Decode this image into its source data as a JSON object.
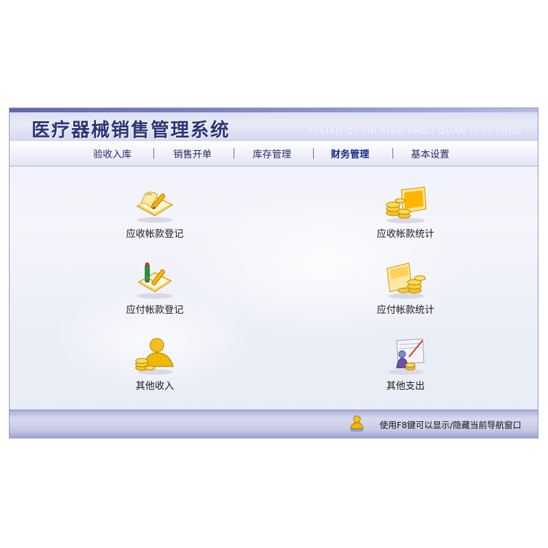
{
  "app": {
    "title": "医疗器械销售管理系统",
    "pinyin": "YI LIAO QI XIE XIAO SHOU GUAN LI XI TONG"
  },
  "nav": {
    "items": [
      {
        "label": "验收入库"
      },
      {
        "label": "销售开单"
      },
      {
        "label": "库存管理"
      },
      {
        "label": "财务管理",
        "active": true
      },
      {
        "label": "基本设置"
      }
    ]
  },
  "tiles": [
    {
      "label": "应收帐款登记",
      "icon": "notebook-pencil-icon"
    },
    {
      "label": "应收帐款统计",
      "icon": "coins-monitor-icon"
    },
    {
      "label": "应付帐款登记",
      "icon": "notebook-pen-icon"
    },
    {
      "label": "应付帐款统计",
      "icon": "coins-cards-icon"
    },
    {
      "label": "其他收入",
      "icon": "person-coins-icon"
    },
    {
      "label": "其他支出",
      "icon": "person-chart-icon"
    }
  ],
  "footer": {
    "hint": "使用F8键可以显示/隐藏当前导航窗口",
    "icon": "user-icon"
  },
  "colors": {
    "title": "#2c3576",
    "nav_text": "#1f2a6b",
    "accent": "#8d96c8",
    "gold": "#f2b705"
  }
}
